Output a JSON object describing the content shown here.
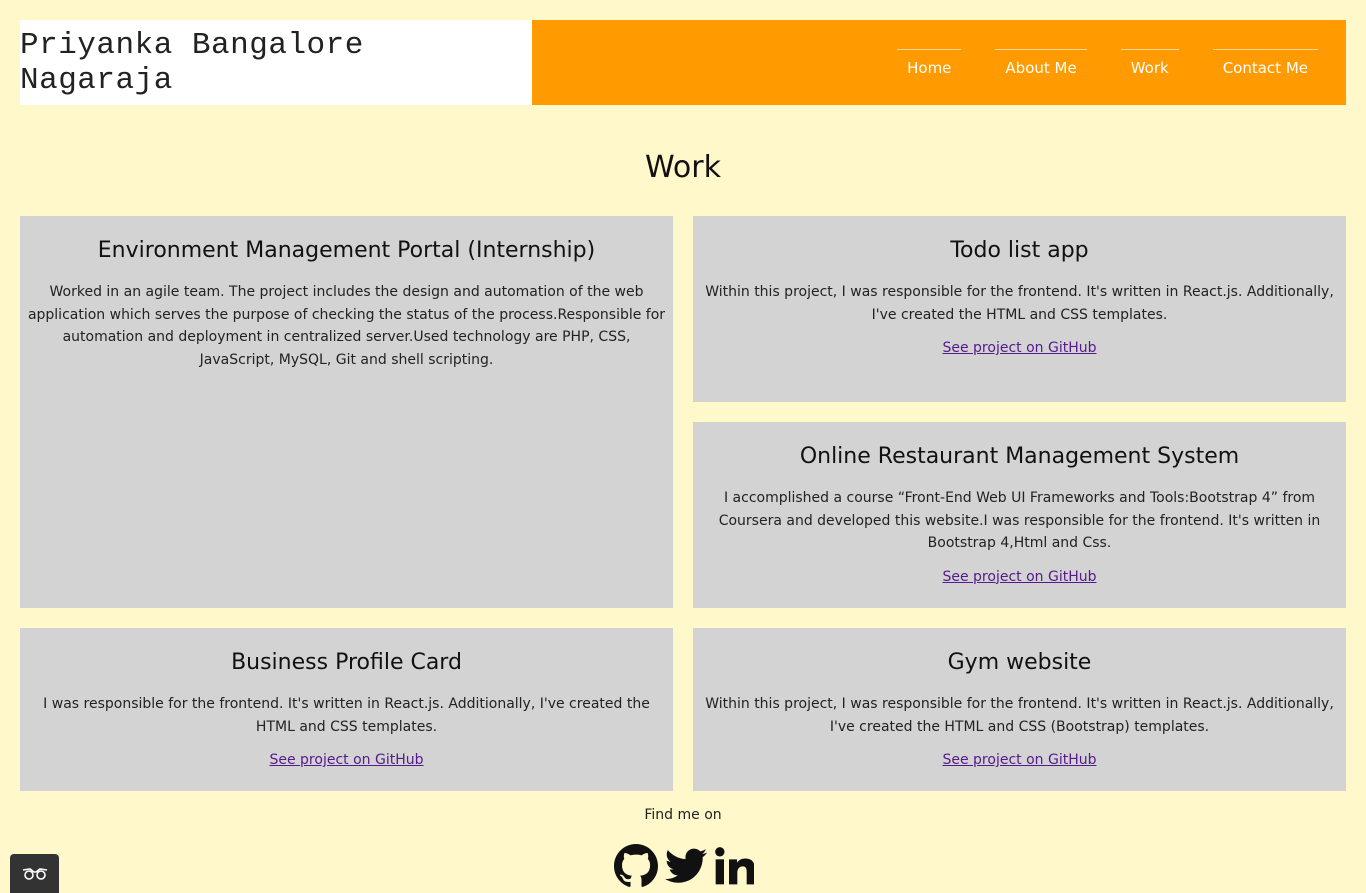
{
  "header": {
    "brand": "Priyanka Bangalore Nagaraja",
    "nav": [
      "Home",
      "About Me",
      "Work",
      "Contact Me"
    ]
  },
  "colors": {
    "background": "#fff8cb",
    "header": "#ff9a00",
    "card": "#d3d3d3",
    "link": "#551a8b"
  },
  "page_title": "Work",
  "projects": [
    {
      "title": "Environment Management Portal (Internship)",
      "description": "Worked in an agile team. The project includes the design and automation of the web application which serves the purpose of checking the status of the process.Responsible for automation and deployment in centralized server.Used technology are PHP, CSS, JavaScript, MySQL, Git and shell scripting.",
      "link": ""
    },
    {
      "title": "Todo list app",
      "description": "Within this project, I was responsible for the frontend. It's written in React.js. Additionally, I've created the HTML and CSS templates.",
      "link": "See project on GitHub"
    },
    {
      "title": "Online Restaurant Management System",
      "description": "I accomplished a course “Front-End Web UI Frameworks and Tools:Bootstrap 4” from Coursera and developed this website.I was responsible for the frontend. It's written in Bootstrap 4,Html and Css.",
      "link": "See project on GitHub"
    },
    {
      "title": "Business Profile Card",
      "description": "I was responsible for the frontend. It's written in React.js. Additionally, I've created the HTML and CSS templates.",
      "link": "See project on GitHub"
    },
    {
      "title": "Gym website",
      "description": "Within this project, I was responsible for the frontend. It's written in React.js. Additionally, I've created the HTML and CSS (Bootstrap) templates.",
      "link": "See project on GitHub"
    }
  ],
  "footer": {
    "text": "Find me on",
    "icons": [
      "github-icon",
      "twitter-icon",
      "linkedin-icon"
    ]
  },
  "widget_icon": "glasses-icon"
}
